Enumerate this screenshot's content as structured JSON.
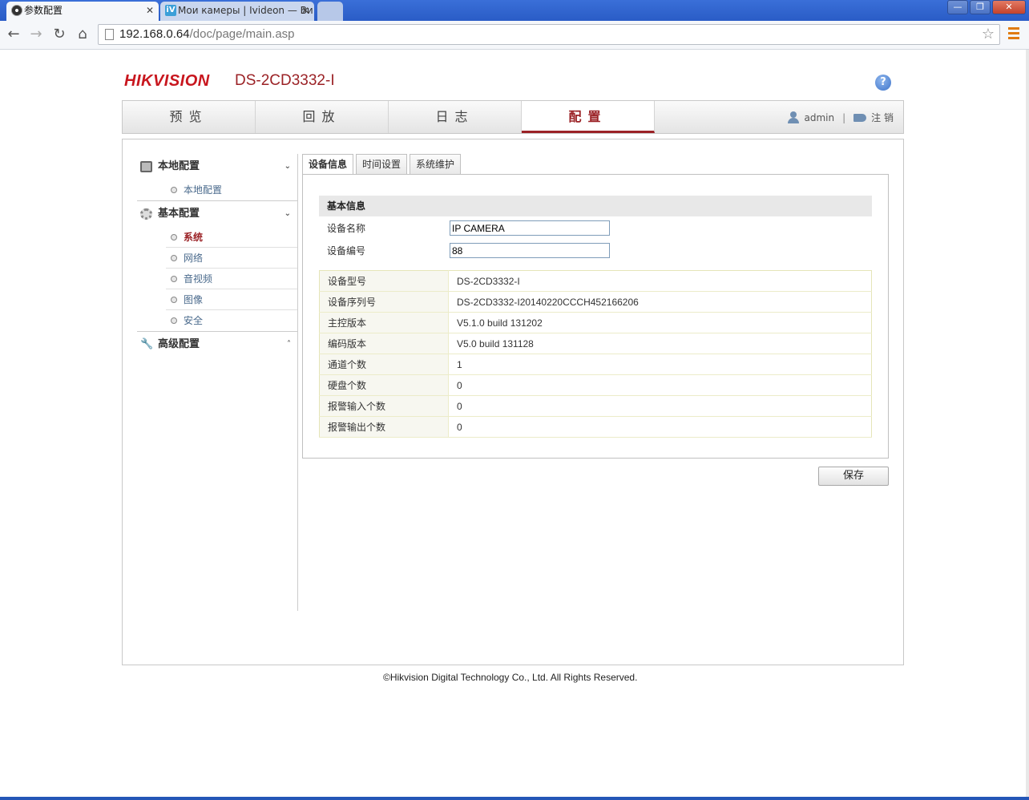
{
  "browser": {
    "tabs": [
      {
        "title": "参数配置",
        "close": "✕"
      },
      {
        "title": "Мои камеры | Ivideon — Ви",
        "close": "✕",
        "favicon": "iV"
      }
    ],
    "window_controls": {
      "minimize": "—",
      "maximize": "❐",
      "close": "✕"
    },
    "url_host": "192.168.0.64",
    "url_path": "/doc/page/main.asp"
  },
  "header": {
    "logo": "HIKVISION",
    "model": "DS-2CD3332-I",
    "help": "?"
  },
  "main_nav": {
    "items": [
      "预览",
      "回放",
      "日志",
      "配置"
    ],
    "active_index": 3
  },
  "user": {
    "name": "admin",
    "separator": "|",
    "logout": "注 销"
  },
  "sidebar": {
    "groups": [
      {
        "label": "本地配置",
        "chevron": "⌄",
        "items": [
          "本地配置"
        ]
      },
      {
        "label": "基本配置",
        "chevron": "⌄",
        "items": [
          "系统",
          "网络",
          "音视频",
          "图像",
          "安全"
        ],
        "active": "系统"
      },
      {
        "label": "高级配置",
        "chevron": "˄",
        "items": []
      }
    ]
  },
  "sub_tabs": [
    "设备信息",
    "时间设置",
    "系统维护"
  ],
  "device_info": {
    "section_title": "基本信息",
    "name_label": "设备名称",
    "name_value": "IP CAMERA",
    "number_label": "设备编号",
    "number_value": "88",
    "rows": [
      {
        "k": "设备型号",
        "v": "DS-2CD3332-I"
      },
      {
        "k": "设备序列号",
        "v": "DS-2CD3332-I20140220CCCH452166206"
      },
      {
        "k": "主控版本",
        "v": "V5.1.0 build 131202"
      },
      {
        "k": "编码版本",
        "v": "V5.0 build 131128"
      },
      {
        "k": "通道个数",
        "v": "1"
      },
      {
        "k": "硬盘个数",
        "v": "0"
      },
      {
        "k": "报警输入个数",
        "v": "0"
      },
      {
        "k": "报警输出个数",
        "v": "0"
      }
    ]
  },
  "save_label": "保存",
  "footer": "©Hikvision Digital Technology Co., Ltd. All Rights Reserved.",
  "colors": {
    "brand_red": "#c8161e",
    "accent": "#9b2226",
    "chrome_blue": "#2a5cc6"
  }
}
